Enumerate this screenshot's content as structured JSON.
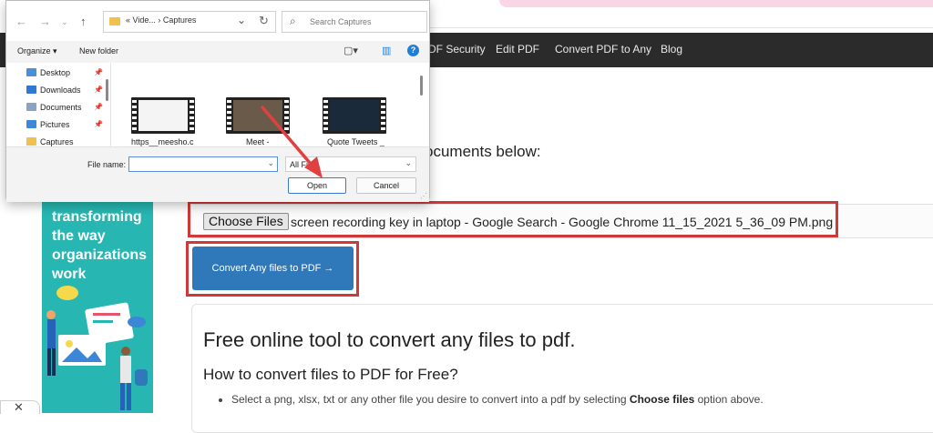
{
  "navbar": {
    "items": [
      "DF Security",
      "Edit PDF",
      "Convert PDF to Any",
      "Blog"
    ]
  },
  "page": {
    "heading_fragment": "ocuments below:",
    "choose_files_label": "Choose Files",
    "selected_file": "screen recording key in laptop - Google Search - Google Chrome 11_15_2021 5_36_09 PM.png",
    "convert_button": "Convert Any files to PDF →",
    "card_title": "Free online tool to convert any files to pdf.",
    "card_subtitle": "How to convert files to PDF for Free?",
    "bullet1_pre": "Select a png, xlsx, txt or any other file you desire to convert into a pdf by selecting ",
    "bullet1_bold": "Choose files",
    "bullet1_post": " option above."
  },
  "ad": {
    "lines": [
      "transforming",
      "the way",
      "organizations",
      "work"
    ]
  },
  "dialog": {
    "address_path": "«  Vide...  ›  Captures",
    "search_placeholder": "Search Captures",
    "toolbar": {
      "organize": "Organize ▾",
      "new_folder": "New folder"
    },
    "tree": [
      {
        "label": "Desktop",
        "color": "#4a90d9"
      },
      {
        "label": "Downloads",
        "color": "#2f7ad0"
      },
      {
        "label": "Documents",
        "color": "#8aa3c2"
      },
      {
        "label": "Pictures",
        "color": "#3f86d8"
      },
      {
        "label": "Captures",
        "color": "#f1c04f"
      }
    ],
    "files": [
      "https__meesho.c",
      "Meet -",
      "Quote Tweets _"
    ],
    "file_name_label": "File name:",
    "file_name_value": "",
    "file_type_value": "All Files",
    "open_button": "Open",
    "cancel_button": "Cancel"
  },
  "colors": {
    "navbar": "#2b2b2b",
    "accent_red": "#d0393a",
    "button_blue": "#2f78ba",
    "ad_teal": "#27b6b1"
  }
}
